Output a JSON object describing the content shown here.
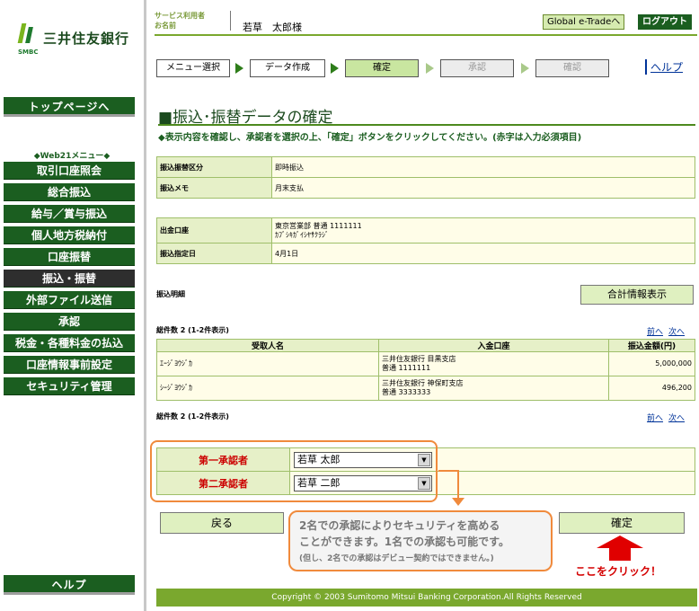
{
  "brand": {
    "name": "三井住友銀行",
    "sub": "SMBC"
  },
  "sidebar": {
    "top_button": "トップページへ",
    "caption": "◆Web21メニュー◆",
    "items": [
      {
        "label": "取引口座照会"
      },
      {
        "label": "総合振込"
      },
      {
        "label": "給与／賞与振込"
      },
      {
        "label": "個人地方税納付"
      },
      {
        "label": "口座振替"
      },
      {
        "label": "振込・振替",
        "active": true
      },
      {
        "label": "外部ファイル送信"
      },
      {
        "label": "承認"
      },
      {
        "label": "税金・各種料金の払込"
      },
      {
        "label": "口座情報事前設定"
      },
      {
        "label": "セキュリティ管理"
      }
    ],
    "help_button": "ヘルプ"
  },
  "header": {
    "label_line1": "サービス利用者",
    "label_line2": "お名前",
    "user_name": "若草　太郎様",
    "global_button": "Global e-Tradeへ",
    "logout_button": "ログアウト"
  },
  "steps": [
    {
      "label": "メニュー選択",
      "state": "done"
    },
    {
      "label": "データ作成",
      "state": "done"
    },
    {
      "label": "確定",
      "state": "current"
    },
    {
      "label": "承認",
      "state": "future"
    },
    {
      "label": "確認",
      "state": "future"
    }
  ],
  "help_link": "ヘルプ",
  "page_title": "■振込･振替データの確定",
  "instruction": "◆表示内容を確認し、承認者を選択の上、「確定」ボタンをクリックしてください。(赤字は入力必須項目)",
  "info1": [
    {
      "label": "振込振替区分",
      "value": "即時振込"
    },
    {
      "label": "振込メモ",
      "value": "月末支払"
    }
  ],
  "info2": {
    "account_label": "出金口座",
    "account_line1": "東京営業部 普通 1111111",
    "account_line2": "ｶﾌﾞｼｷｶﾞｲｼﾔｻｸﾗｼﾞ",
    "date_label": "振込指定日",
    "date_value": "4月1日"
  },
  "details": {
    "label": "振込明細",
    "sum_button": "合計情報表示",
    "count_text": "総件数 2 (1-2件表示)",
    "prev": "前へ",
    "next": "次へ",
    "columns": [
      "受取人名",
      "入金口座",
      "振込金額(円)"
    ],
    "rows": [
      {
        "name": "ｴｰｼﾞﾖｳｼﾞｶ",
        "bank": "三井住友銀行 目黒支店",
        "account": "普通 1111111",
        "amount": "5,000,000"
      },
      {
        "name": "ｼｰｼﾞﾖｳｼﾞｶ",
        "bank": "三井住友銀行 神保町支店",
        "account": "普通 3333333",
        "amount": "496,200"
      }
    ]
  },
  "approvers": [
    {
      "label": "第一承認者",
      "value": "若草 太郎"
    },
    {
      "label": "第二承認者",
      "value": "若草 二郎"
    }
  ],
  "buttons": {
    "back": "戻る",
    "confirm": "確定"
  },
  "callout": {
    "line1": "2名での承認によりセキュリティを高める",
    "line2": "ことができます。1名での承認も可能です。",
    "line3": "(但し、2名での承認はデビュー契約ではできません。)"
  },
  "click_here": "ここをクリック！",
  "footer": "Copyright © 2003 Sumitomo Mitsui Banking Corporation.All Rights Reserved",
  "colors": {
    "brand_green": "#1b5e20",
    "accent_green": "#7aa82e",
    "header_cell": "#e6f0c8",
    "value_cell": "#fffde8",
    "callout_border": "#f08a3c",
    "required_red": "#cc0000"
  },
  "icons": [
    "smbc-logo-mark",
    "dropdown-arrow-icon",
    "step-arrow-icon",
    "red-up-arrow-icon",
    "callout-arrow-icon"
  ]
}
